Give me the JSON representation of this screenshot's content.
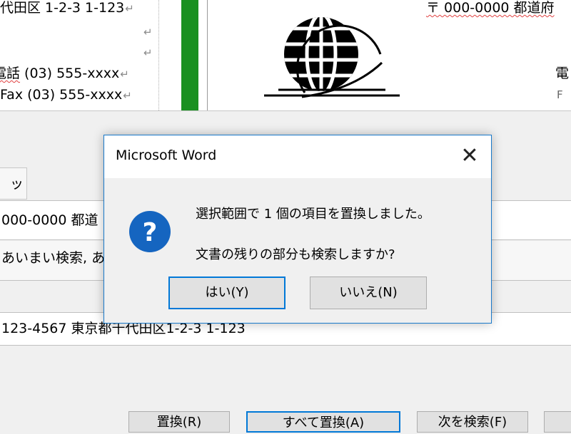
{
  "document": {
    "line1": "代田区 1-2-3 1-123",
    "line4_label": "電話",
    "line4_value": " (03) 555-xxxx",
    "line5": "Fax (03) 555-xxxx",
    "paragraph_mark": "↵",
    "right_address": "〒 000-0000 都道府",
    "right_tel": "電",
    "right_fax": "F"
  },
  "find_replace": {
    "tab_fragment": "ップ",
    "find_text": "000-0000 都道",
    "options_text": "あいまい検索, あいまい",
    "replace_text": "123-4567 東京都千代田区1-2-3 1-123",
    "buttons": {
      "replace": "置換(R)",
      "replace_all": "すべて置換(A)",
      "find_next": "次を検索(F)"
    }
  },
  "message_box": {
    "title": "Microsoft Word",
    "close_glyph": "✕",
    "icon_glyph": "?",
    "message_line1": "選択範囲で 1 個の項目を置換しました。",
    "message_line2": "文書の残りの部分も検索しますか?",
    "yes_label": "はい(Y)",
    "no_label": "いいえ(N)"
  },
  "colors": {
    "accent": "#0078d7",
    "icon_blue": "#1565c0",
    "green_bar": "#1a9020"
  }
}
